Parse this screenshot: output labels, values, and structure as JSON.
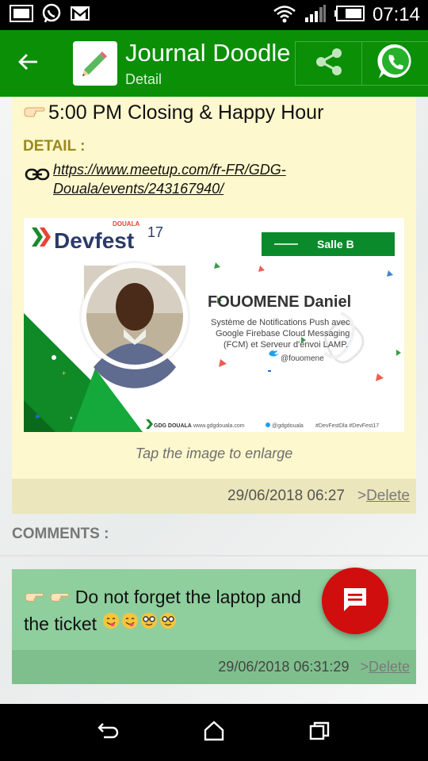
{
  "status_bar": {
    "time": "07:14",
    "icons": [
      "picture-icon",
      "whatsapp-icon",
      "gmail-icon",
      "wifi-icon",
      "signal-icon",
      "battery-icon"
    ]
  },
  "app_bar": {
    "title": "Journal Doodle",
    "subtitle": "Detail",
    "back_icon": "back-arrow-icon",
    "share_icon": "share-icon",
    "whatsapp_icon": "whatsapp-icon"
  },
  "post": {
    "title": "5:00 PM Closing & Happy Hour",
    "detail_label": "DETAIL :",
    "link": "https://www.meetup.com/fr-FR/GDG-Douala/events/243167940/",
    "tap_hint": "Tap the image to enlarge",
    "date": "29/06/2018 06:27",
    "delete_prefix": ">",
    "delete_label": "Delete",
    "banner": {
      "brand_small": "DOUALA",
      "brand": "Devfest",
      "brand_year": "17",
      "room": "Salle B",
      "speaker": "FOUOMENE Daniel",
      "talk_lines": [
        "Système de Notifications Push avec",
        "Google Firebase Cloud Messaging",
        "(FCM) et Serveur d'envoi LAMP."
      ],
      "twitter": "@fouomene",
      "footer_org": "GDG DOUALA",
      "footer_site": "www.gdgdouala.com",
      "footer_twitter": "@gdgdouala",
      "footer_tags": "#DevFestDla #DevFest17"
    }
  },
  "comments": {
    "label": "COMMENTS :",
    "items": [
      {
        "text": "Do not forget the laptop and the ticket",
        "date": "29/06/2018 06:31:29",
        "delete_prefix": ">",
        "delete_label": "Delete"
      }
    ]
  },
  "fab": {
    "icon": "comment-icon"
  },
  "nav_bar": {
    "icons": [
      "back-nav-icon",
      "home-icon",
      "recents-icon"
    ]
  },
  "colors": {
    "app_bar": "#0a8f06",
    "post_card": "#fdf8cd",
    "comment_card": "#8fcf9d",
    "fab": "#d10e0e"
  }
}
